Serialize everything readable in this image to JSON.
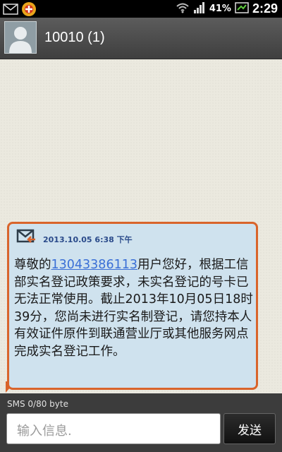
{
  "status_bar": {
    "battery_text": "41%",
    "time": "2:29",
    "icons": [
      "mail-icon",
      "notification-badge-icon",
      "wifi-icon",
      "signal-icon",
      "battery-icon"
    ]
  },
  "header": {
    "title": "10010 (1)",
    "avatar_icon": "contact-avatar-icon"
  },
  "message": {
    "timestamp": "2013.10.05 6:38 下午",
    "body_before": "尊敬的",
    "phone": "13043386113",
    "body_after": "用户您好，根据工信部实名登记政策要求，未实名登记的号卡已无法正常使用。截止2013年10月05日18时39分，您尚未进行实名制登记，请您持本人有效证件原件到联通营业厅或其他服务网点完成实名登记工作。",
    "icon": "sms-received-icon"
  },
  "compose": {
    "counter": "SMS  0/80 byte",
    "placeholder": "输入信息.",
    "send_label": "发送"
  },
  "colors": {
    "bubble_border": "#d9642b",
    "bubble_fill": "#cfe2ee",
    "link": "#3a6fd6"
  }
}
